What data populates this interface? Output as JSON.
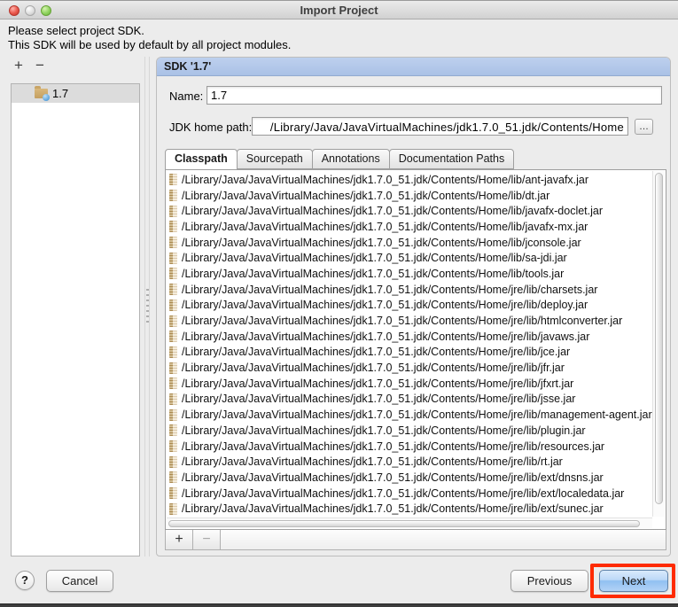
{
  "window": {
    "title": "Import Project"
  },
  "instructions": {
    "line1": "Please select project SDK.",
    "line2": "This SDK will be used by default by all project modules."
  },
  "sidebar": {
    "add_label": "+",
    "remove_label": "−",
    "items": [
      {
        "label": "1.7",
        "selected": true
      }
    ]
  },
  "panel": {
    "header": "SDK '1.7'",
    "name_label": "Name:",
    "name_value": "1.7",
    "jdk_home_label": "JDK home path:",
    "jdk_home_value": "/Library/Java/JavaVirtualMachines/jdk1.7.0_51.jdk/Contents/Home",
    "browse_label": "…",
    "tabs": [
      {
        "label": "Classpath",
        "selected": true
      },
      {
        "label": "Sourcepath",
        "selected": false
      },
      {
        "label": "Annotations",
        "selected": false
      },
      {
        "label": "Documentation Paths",
        "selected": false
      }
    ],
    "classpath_entries": [
      "/Library/Java/JavaVirtualMachines/jdk1.7.0_51.jdk/Contents/Home/lib/ant-javafx.jar",
      "/Library/Java/JavaVirtualMachines/jdk1.7.0_51.jdk/Contents/Home/lib/dt.jar",
      "/Library/Java/JavaVirtualMachines/jdk1.7.0_51.jdk/Contents/Home/lib/javafx-doclet.jar",
      "/Library/Java/JavaVirtualMachines/jdk1.7.0_51.jdk/Contents/Home/lib/javafx-mx.jar",
      "/Library/Java/JavaVirtualMachines/jdk1.7.0_51.jdk/Contents/Home/lib/jconsole.jar",
      "/Library/Java/JavaVirtualMachines/jdk1.7.0_51.jdk/Contents/Home/lib/sa-jdi.jar",
      "/Library/Java/JavaVirtualMachines/jdk1.7.0_51.jdk/Contents/Home/lib/tools.jar",
      "/Library/Java/JavaVirtualMachines/jdk1.7.0_51.jdk/Contents/Home/jre/lib/charsets.jar",
      "/Library/Java/JavaVirtualMachines/jdk1.7.0_51.jdk/Contents/Home/jre/lib/deploy.jar",
      "/Library/Java/JavaVirtualMachines/jdk1.7.0_51.jdk/Contents/Home/jre/lib/htmlconverter.jar",
      "/Library/Java/JavaVirtualMachines/jdk1.7.0_51.jdk/Contents/Home/jre/lib/javaws.jar",
      "/Library/Java/JavaVirtualMachines/jdk1.7.0_51.jdk/Contents/Home/jre/lib/jce.jar",
      "/Library/Java/JavaVirtualMachines/jdk1.7.0_51.jdk/Contents/Home/jre/lib/jfr.jar",
      "/Library/Java/JavaVirtualMachines/jdk1.7.0_51.jdk/Contents/Home/jre/lib/jfxrt.jar",
      "/Library/Java/JavaVirtualMachines/jdk1.7.0_51.jdk/Contents/Home/jre/lib/jsse.jar",
      "/Library/Java/JavaVirtualMachines/jdk1.7.0_51.jdk/Contents/Home/jre/lib/management-agent.jar",
      "/Library/Java/JavaVirtualMachines/jdk1.7.0_51.jdk/Contents/Home/jre/lib/plugin.jar",
      "/Library/Java/JavaVirtualMachines/jdk1.7.0_51.jdk/Contents/Home/jre/lib/resources.jar",
      "/Library/Java/JavaVirtualMachines/jdk1.7.0_51.jdk/Contents/Home/jre/lib/rt.jar",
      "/Library/Java/JavaVirtualMachines/jdk1.7.0_51.jdk/Contents/Home/jre/lib/ext/dnsns.jar",
      "/Library/Java/JavaVirtualMachines/jdk1.7.0_51.jdk/Contents/Home/jre/lib/ext/localedata.jar",
      "/Library/Java/JavaVirtualMachines/jdk1.7.0_51.jdk/Contents/Home/jre/lib/ext/sunec.jar"
    ],
    "list_toolbar": {
      "add_label": "+",
      "remove_label": "−"
    }
  },
  "footer": {
    "help_label": "?",
    "cancel_label": "Cancel",
    "previous_label": "Previous",
    "next_label": "Next"
  },
  "colors": {
    "panel_header_blue": "#b7cbec",
    "selection_gray": "#dcdcdc",
    "annotation_red": "#fe2b01",
    "next_button_blue": "#a6cdf4"
  }
}
